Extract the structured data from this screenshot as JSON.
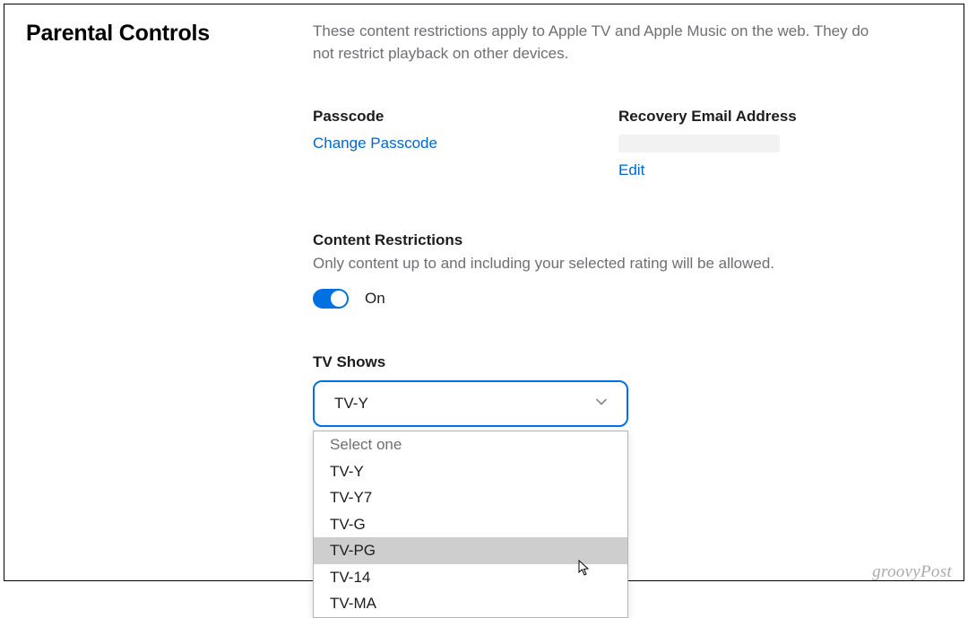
{
  "page_title": "Parental Controls",
  "description": "These content restrictions apply to Apple TV and Apple Music on the web. They do not restrict playback on other devices.",
  "passcode": {
    "label": "Passcode",
    "change_link": "Change Passcode"
  },
  "recovery_email": {
    "label": "Recovery Email Address",
    "edit_link": "Edit"
  },
  "content_restrictions": {
    "title": "Content Restrictions",
    "description": "Only content up to and including your selected rating will be allowed.",
    "toggle_state": "On"
  },
  "tv_shows": {
    "label": "TV Shows",
    "selected": "TV-Y",
    "options": [
      {
        "label": "Select one",
        "placeholder": true
      },
      {
        "label": "TV-Y"
      },
      {
        "label": "TV-Y7"
      },
      {
        "label": "TV-G"
      },
      {
        "label": "TV-PG",
        "highlighted": true
      },
      {
        "label": "TV-14"
      },
      {
        "label": "TV-MA"
      }
    ]
  },
  "watermark": "groovyPost"
}
